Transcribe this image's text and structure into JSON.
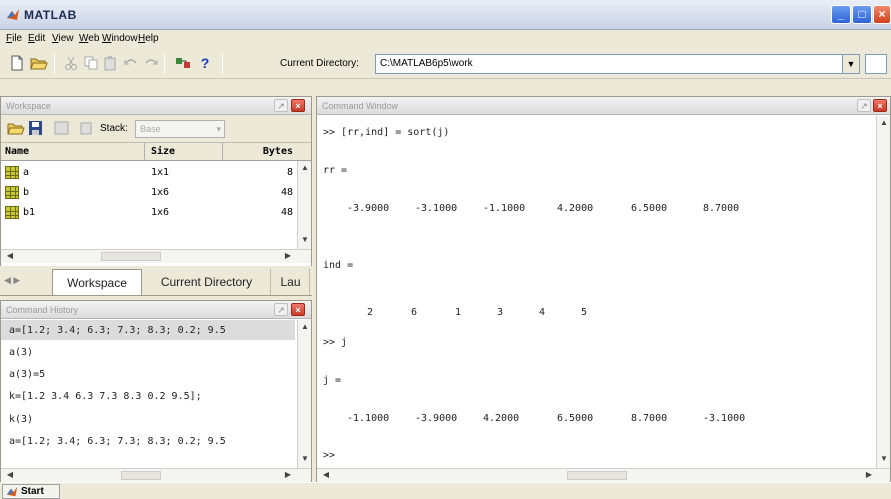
{
  "window": {
    "title": "MATLAB"
  },
  "menu": [
    "File",
    "Edit",
    "View",
    "Web",
    "Window",
    "Help"
  ],
  "toolbar": {
    "current_dir_label": "Current Directory:",
    "current_dir_value": "C:\\MATLAB6p5\\work",
    "help_glyph": "?"
  },
  "workspace": {
    "title": "Workspace",
    "stack_label": "Stack:",
    "stack_value": "Base",
    "columns": {
      "name": "Name",
      "size": "Size",
      "bytes": "Bytes"
    },
    "rows": [
      {
        "name": "a",
        "size": "1x1",
        "bytes": "8"
      },
      {
        "name": "b",
        "size": "1x6",
        "bytes": "48"
      },
      {
        "name": "b1",
        "size": "1x6",
        "bytes": "48"
      }
    ]
  },
  "tabs": {
    "workspace": "Workspace",
    "current_directory": "Current Directory",
    "launch_pad": "Lau"
  },
  "history": {
    "title": "Command History",
    "lines": [
      "a=[1.2; 3.4; 6.3; 7.3; 8.3; 0.2; 9.5",
      "a(3)",
      "a(3)=5",
      "k=[1.2 3.4 6.3 7.3 8.3 0.2 9.5];",
      "k(3)",
      "a=[1.2; 3.4; 6.3; 7.3; 8.3; 0.2; 9.5"
    ]
  },
  "command_window": {
    "title": "Command Window",
    "prompt1": ">> [rr,ind] = sort(j)",
    "rr_label": "rr =",
    "rr_values": [
      "-3.9000",
      "-3.1000",
      "-1.1000",
      "4.2000",
      "6.5000",
      "8.7000"
    ],
    "ind_label": "ind =",
    "ind_values": [
      "2",
      "6",
      "1",
      "3",
      "4",
      "5"
    ],
    "prompt2": ">> j",
    "j_label": "j =",
    "j_values": [
      "-1.1000",
      "-3.9000",
      "4.2000",
      "6.5000",
      "8.7000",
      "-3.1000"
    ],
    "prompt3": ">>"
  },
  "status": {
    "start": "Start"
  }
}
